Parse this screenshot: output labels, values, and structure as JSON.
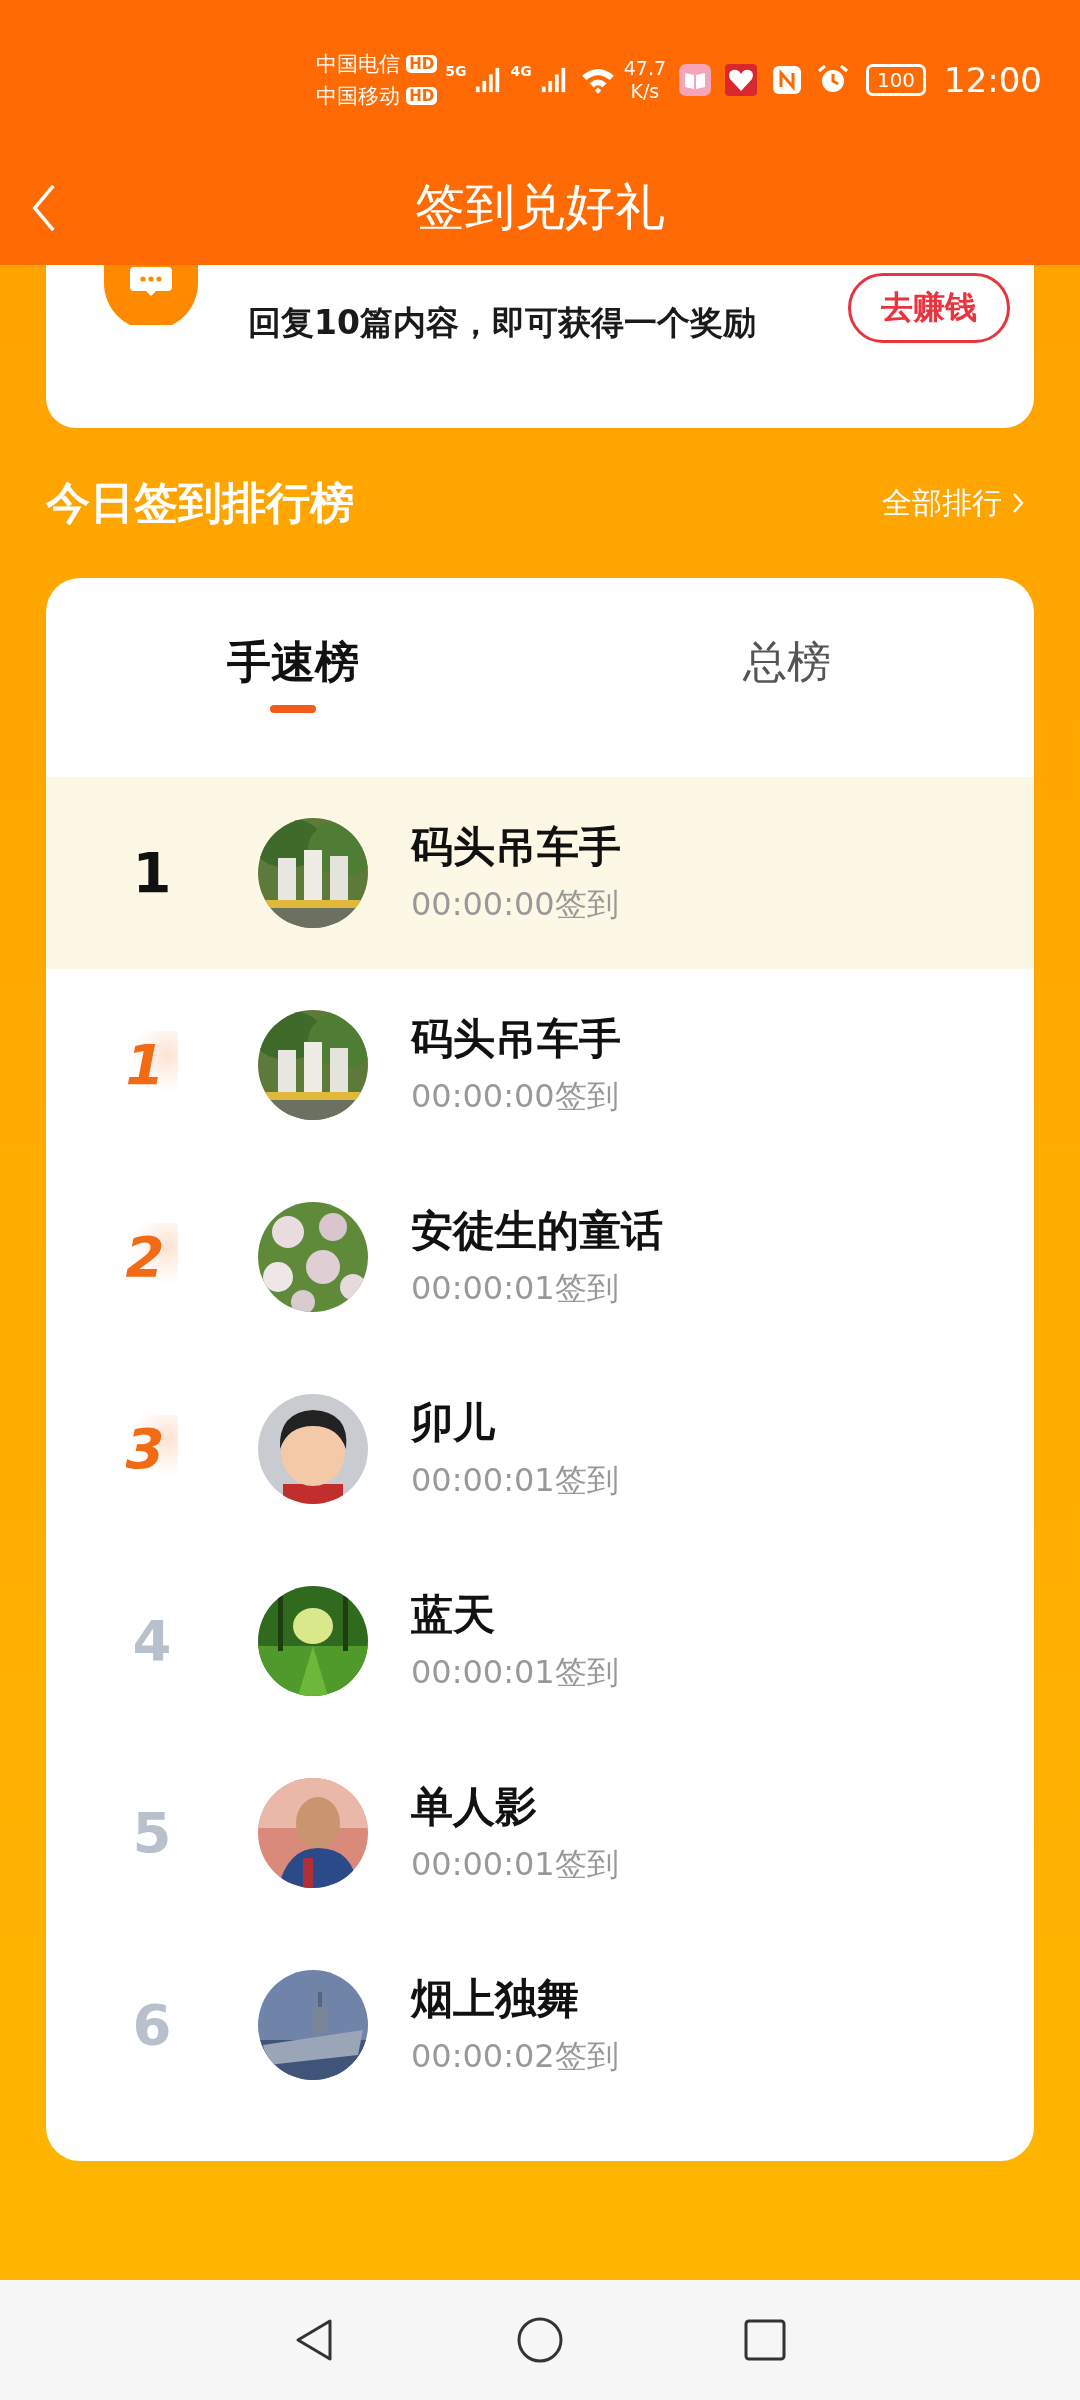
{
  "status_bar": {
    "carriers": [
      {
        "name": "中国电信",
        "badge": "HD"
      },
      {
        "name": "中国移动",
        "badge": "HD"
      }
    ],
    "network_1": "5G",
    "network_2": "4G",
    "speed_value": "47.7",
    "speed_unit": "K/s",
    "battery": "100",
    "time": "12:00"
  },
  "header": {
    "title": "签到兑好礼"
  },
  "task_card": {
    "description": "回复10篇内容，即可获得一个奖励",
    "button": "去赚钱"
  },
  "ranking": {
    "title": "今日签到排行榜",
    "more_link": "全部排行",
    "tabs": [
      {
        "label": "手速榜",
        "selected": true
      },
      {
        "label": "总榜",
        "selected": false
      }
    ],
    "rows": [
      {
        "rank": "1",
        "kind": "self",
        "highlighted": true,
        "name": "码头吊车手",
        "time": "00:00:00签到"
      },
      {
        "rank": "1",
        "kind": "top",
        "highlighted": false,
        "name": "码头吊车手",
        "time": "00:00:00签到"
      },
      {
        "rank": "2",
        "kind": "top",
        "highlighted": false,
        "name": "安徒生的童话",
        "time": "00:00:01签到"
      },
      {
        "rank": "3",
        "kind": "top",
        "highlighted": false,
        "name": "卯儿",
        "time": "00:00:01签到"
      },
      {
        "rank": "4",
        "kind": "plain",
        "highlighted": false,
        "name": "蓝天",
        "time": "00:00:01签到"
      },
      {
        "rank": "5",
        "kind": "plain",
        "highlighted": false,
        "name": "单人影",
        "time": "00:00:01签到"
      },
      {
        "rank": "6",
        "kind": "plain",
        "highlighted": false,
        "name": "烟上独舞",
        "time": "00:00:02签到"
      }
    ]
  }
}
